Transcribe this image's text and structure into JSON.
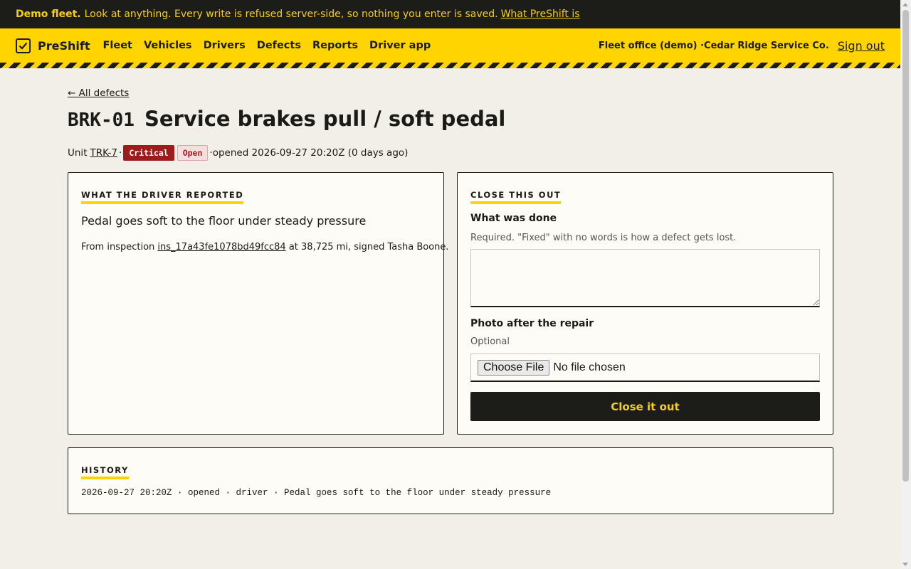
{
  "banner": {
    "bold": "Demo fleet.",
    "text": "Look at anything. Every write is refused server-side, so nothing you enter is saved.",
    "link": "What PreShift is"
  },
  "nav": {
    "brand": "PreShift",
    "brand_icon": "checkbox-icon",
    "items": [
      "Fleet",
      "Vehicles",
      "Drivers",
      "Defects",
      "Reports",
      "Driver app"
    ],
    "office": "Fleet office (demo) ·Cedar Ridge Service Co.",
    "signout": "Sign out",
    "colors": {
      "accent": "#ffd400",
      "dark": "#1c1c18"
    }
  },
  "page": {
    "back": "← All defects",
    "code": "BRK-01",
    "title": "Service brakes pull / soft pedal",
    "meta": {
      "unit_prefix": "Unit",
      "unit": "TRK-7",
      "severity": "Critical",
      "status": "Open",
      "opened": "·opened 2026-09-27 20:20Z (0 days ago)"
    }
  },
  "report": {
    "heading": "WHAT THE DRIVER REPORTED",
    "text": "Pedal goes soft to the floor under steady pressure",
    "from_prefix": "From inspection",
    "inspection_id": "ins_17a43fe1078bd49fcc84",
    "from_suffix": "at 38,725 mi, signed Tasha Boone."
  },
  "close": {
    "heading": "CLOSE THIS OUT",
    "what_label": "What was done",
    "what_help": "Required. \"Fixed\" with no words is how a defect gets lost.",
    "what_value": "",
    "photo_label": "Photo after the repair",
    "photo_help": "Optional",
    "file_button": "Choose File",
    "file_status": "No file chosen",
    "submit": "Close it out"
  },
  "history": {
    "heading": "HISTORY",
    "entries": [
      "2026-09-27 20:20Z · opened · driver · Pedal goes soft to the floor under steady pressure"
    ]
  }
}
